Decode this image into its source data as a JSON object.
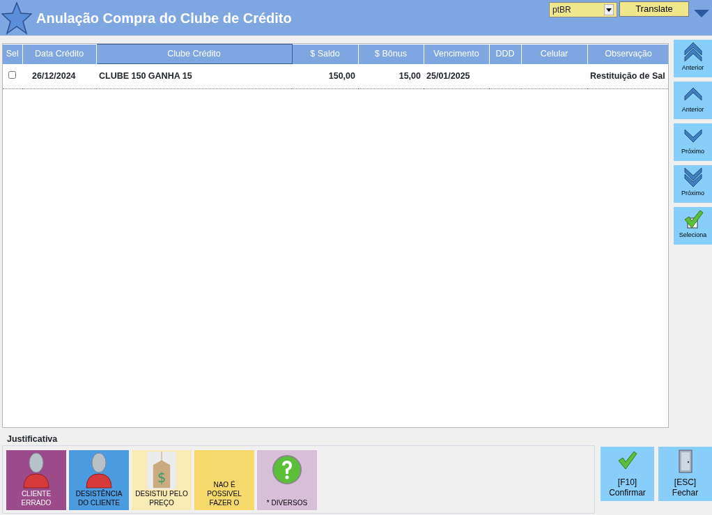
{
  "window": {
    "title": "Anulação Compra do Clube de Crédito"
  },
  "language": {
    "value": "ptBR"
  },
  "translate_button": "Translate",
  "table": {
    "columns": [
      {
        "label": "Sel",
        "selected": false
      },
      {
        "label": "Data Crédito",
        "selected": false
      },
      {
        "label": "Clube Crédito",
        "selected": true
      },
      {
        "label": "$ Saldo",
        "selected": false
      },
      {
        "label": "$ Bônus",
        "selected": false
      },
      {
        "label": "Vencimento",
        "selected": false
      },
      {
        "label": "DDD",
        "selected": false
      },
      {
        "label": "Celular",
        "selected": false
      },
      {
        "label": "Observação",
        "selected": false
      }
    ],
    "rows": [
      {
        "checked": false,
        "cells": [
          "",
          "26/12/2024",
          "CLUBE 150 GANHA 15",
          "150,00",
          "15,00",
          "25/01/2025",
          "",
          "",
          "Restituição de Sal"
        ]
      }
    ]
  },
  "nav_buttons": [
    {
      "kind": "double-up",
      "label": "Anterior"
    },
    {
      "kind": "up",
      "label": "Anterior"
    },
    {
      "kind": "down",
      "label": "Próximo"
    },
    {
      "kind": "double-down",
      "label": "Próximo"
    },
    {
      "kind": "check",
      "label": "Seleciona"
    }
  ],
  "justification": {
    "title": "Justificativa",
    "items": [
      {
        "kind": "person",
        "label": "CLIENTE ERRADO",
        "color": "#9b4a8a"
      },
      {
        "kind": "person",
        "label": "DESISTÊNCIA DO CLIENTE",
        "color": "#4a9be0"
      },
      {
        "kind": "tag",
        "label": "DESISTIU PELO PREÇO",
        "color": "#faebb4",
        "symbol": "$"
      },
      {
        "kind": "none",
        "label": "NAO É POSSIVEL FAZER O",
        "color": "#f5d96a"
      },
      {
        "kind": "question",
        "label": "* DIVERSOS",
        "color": "#d8bfd8"
      }
    ]
  },
  "actions": [
    {
      "kind": "check",
      "key": "[F10]",
      "label": "Confirmar"
    },
    {
      "kind": "door",
      "key": "[ESC]",
      "label": "Fechar"
    }
  ]
}
